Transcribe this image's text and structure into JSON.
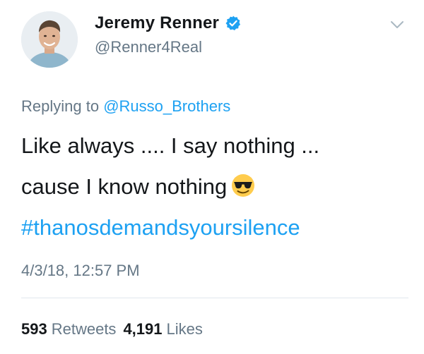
{
  "author": {
    "display_name": "Jeremy Renner",
    "handle": "@Renner4Real",
    "verified": true
  },
  "reply": {
    "prefix": "Replying to",
    "mention": "@Russo_Brothers"
  },
  "tweet": {
    "line1": "Like always .... I say nothing ...",
    "line2": "cause I know nothing",
    "emoji": "smiling-face-with-sunglasses",
    "hashtag": "#thanosdemandsyoursilence"
  },
  "timestamp": "4/3/18, 12:57 PM",
  "stats": {
    "retweets_count": "593",
    "retweets_label": "Retweets",
    "likes_count": "4,191",
    "likes_label": "Likes"
  },
  "colors": {
    "link": "#1da1f2",
    "secondary_text": "#657786",
    "primary_text": "#14171a",
    "divider": "#e1e8ed"
  },
  "icons": {
    "verified": "verified-badge-icon",
    "menu": "chevron-down-icon"
  }
}
